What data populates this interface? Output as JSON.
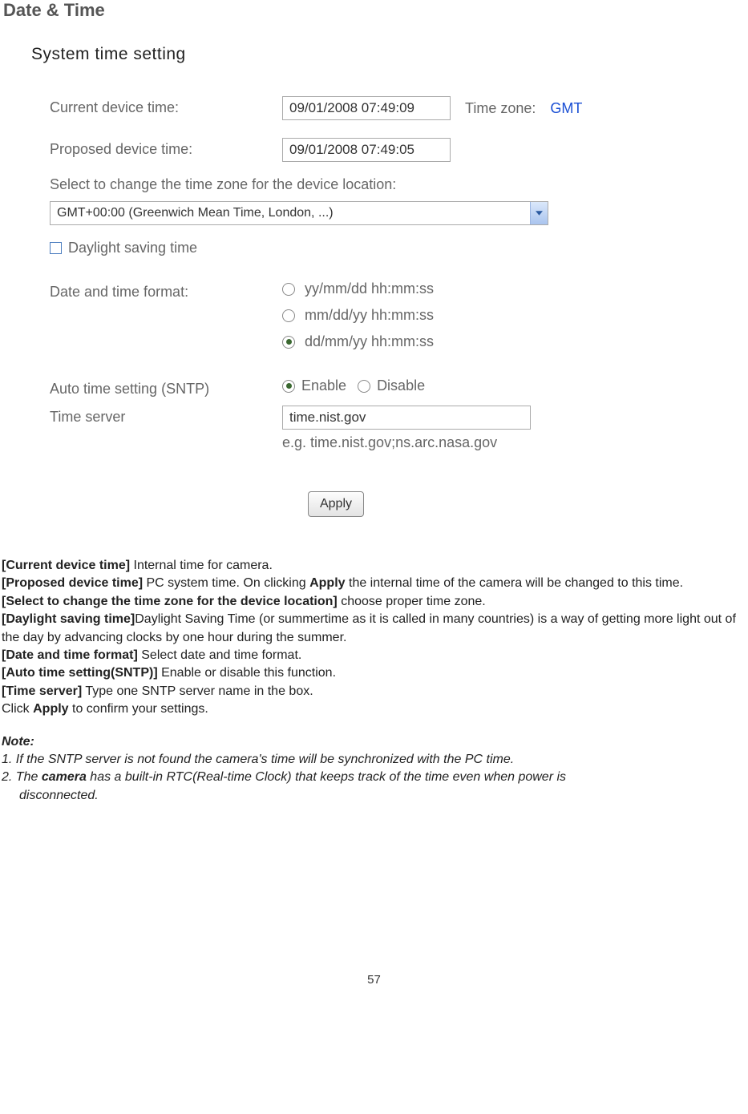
{
  "title": "Date & Time",
  "panel": {
    "heading": "System time setting",
    "current_time_label": "Current device time:",
    "current_time_value": "09/01/2008 07:49:09",
    "timezone_label": "Time zone:",
    "timezone_value": "GMT",
    "proposed_time_label": "Proposed device time:",
    "proposed_time_value": "09/01/2008 07:49:05",
    "select_tz_label": "Select to change the time zone for the device location:",
    "tz_select_value": "GMT+00:00 (Greenwich Mean Time, London, ...)",
    "dst_label": "Daylight saving time",
    "format_label": "Date and time format:",
    "format_options": [
      "yy/mm/dd hh:mm:ss",
      "mm/dd/yy hh:mm:ss",
      "dd/mm/yy hh:mm:ss"
    ],
    "format_selected_index": 2,
    "sntp_label": "Auto time setting (SNTP)",
    "sntp_enable": "Enable",
    "sntp_disable": "Disable",
    "sntp_selected": "enable",
    "time_server_label": "Time server",
    "time_server_value": "time.nist.gov",
    "time_server_example": "e.g. time.nist.gov;ns.arc.nasa.gov",
    "apply_label": "Apply"
  },
  "descriptions": {
    "current_device_time_key": "[Current device time]",
    "current_device_time_text": " Internal time for camera.",
    "proposed_device_time_key": "[Proposed device time]",
    "proposed_device_time_text_a": " PC system time. On clicking ",
    "proposed_device_time_apply": "Apply",
    "proposed_device_time_text_b": " the internal time of the camera will be changed to this time.",
    "select_tz_key": "[Select to change the time zone for the device location]",
    "select_tz_text": " choose proper time zone.",
    "dst_key": "[Daylight saving time]",
    "dst_text": "Daylight Saving Time (or summertime as it is called in many countries) is a way of getting more light out of the day by advancing clocks by one hour during the summer.",
    "format_key": "[Date and time format]",
    "format_text": " Select date and time format.",
    "sntp_key": "[Auto time setting(SNTP)]",
    "sntp_text": " Enable or disable this function.",
    "server_key": "[Time server]",
    "server_text": " Type one SNTP server name in the box.",
    "click_apply_a": "Click ",
    "click_apply_b": "Apply",
    "click_apply_c": " to confirm your settings."
  },
  "note": {
    "heading": "Note:",
    "line1": "1. If the SNTP server is not found the camera's time will be synchronized with the PC time.",
    "line2a": "2. The ",
    "line2b": "camera",
    "line2c": " has a built-in RTC(Real-time Clock) that keeps track of the time even when power is",
    "line2d": "disconnected."
  },
  "page_number": "57"
}
